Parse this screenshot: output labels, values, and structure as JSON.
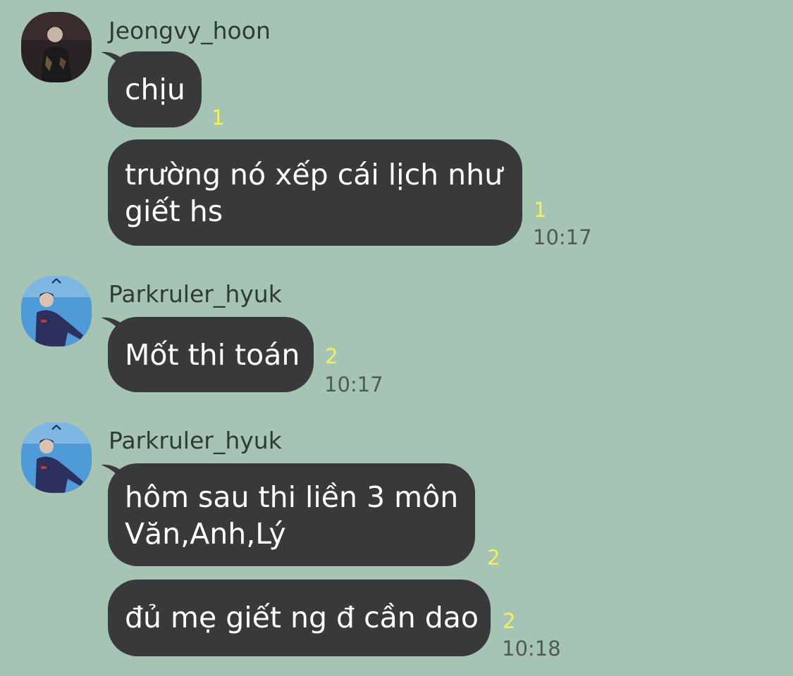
{
  "colors": {
    "background": "#a5c4b4",
    "bubble": "#39393b",
    "bubble_text": "#ffffff",
    "unread": "#f3f05a",
    "time": "#4f5a54",
    "sender": "#2f3a34"
  },
  "groups": [
    {
      "sender": "Jeongvy_hoon",
      "avatar_icon": "user-avatar-icon",
      "messages": [
        {
          "lines": [
            "chịu"
          ],
          "unread": "1",
          "time": ""
        },
        {
          "lines": [
            "trường nó xếp cái lịch như",
            "giết hs"
          ],
          "unread": "1",
          "time": "10:17"
        }
      ]
    },
    {
      "sender": "Parkruler_hyuk",
      "avatar_icon": "user-avatar-icon",
      "messages": [
        {
          "lines": [
            "Mốt thi toán"
          ],
          "unread": "2",
          "time": "10:17"
        }
      ]
    },
    {
      "sender": "Parkruler_hyuk",
      "avatar_icon": "user-avatar-icon",
      "messages": [
        {
          "lines": [
            "hôm sau thi liền 3 môn",
            "Văn,Anh,Lý"
          ],
          "unread": "2",
          "time": ""
        },
        {
          "lines": [
            "đủ mẹ giết ng đ cần dao"
          ],
          "unread": "2",
          "time": "10:18"
        }
      ]
    }
  ]
}
